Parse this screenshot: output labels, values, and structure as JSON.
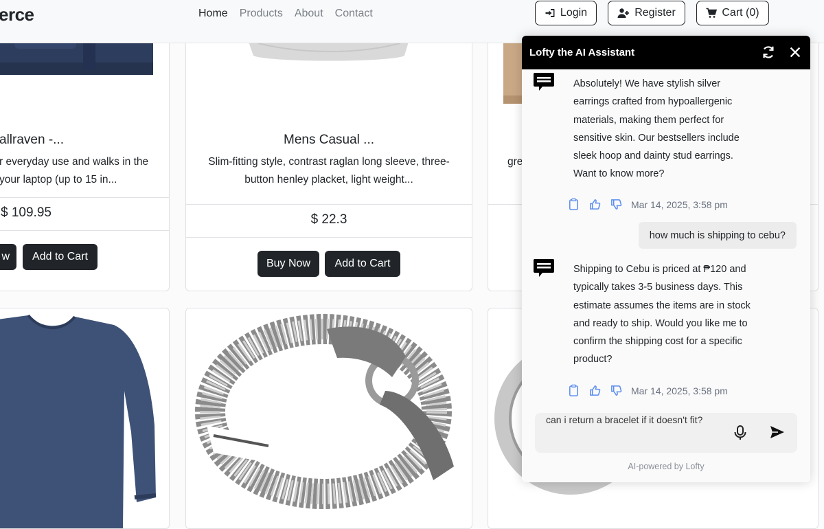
{
  "nav": {
    "brand": "erce",
    "links": [
      "Home",
      "Products",
      "About",
      "Contact"
    ],
    "login": "Login",
    "register": "Register",
    "cart": "Cart (0)"
  },
  "products": [
    {
      "title": "allraven -...",
      "desc_line1": "r everyday use and walks in the",
      "desc_line2": "your laptop (up to 15 in...",
      "price": "$ 109.95",
      "buy": "w",
      "add": "Add to Cart"
    },
    {
      "title": "Mens Casual ...",
      "desc_line1": "Slim-fitting style, contrast raglan long sleeve, three-",
      "desc_line2": "button henley placket, light weight...",
      "price": "$ 22.3",
      "buy": "Buy Now",
      "add": "Add to Cart"
    },
    {
      "desc_fragment": "gre"
    }
  ],
  "chat": {
    "title": "Lofty the AI Assistant",
    "messages": [
      {
        "role": "bot",
        "text": "Absolutely! We have stylish silver earrings crafted from hypoallergenic materials, making them perfect for sensitive skin. Our bestsellers include sleek hoop and dainty stud earrings. Want to know more?",
        "time": "Mar 14, 2025, 3:58 pm"
      },
      {
        "role": "user",
        "text": "how much is shipping to cebu?"
      },
      {
        "role": "bot",
        "text": "Shipping to Cebu is priced at ₱120 and typically takes 3-5 business days. This estimate assumes the items are in stock and ready to ship. Would you like me to confirm the shipping cost for a specific product?",
        "time": "Mar 14, 2025, 3:58 pm"
      }
    ],
    "input_value": "can i return a bracelet if it doesn't fit?",
    "footer": "AI-powered by Lofty"
  }
}
